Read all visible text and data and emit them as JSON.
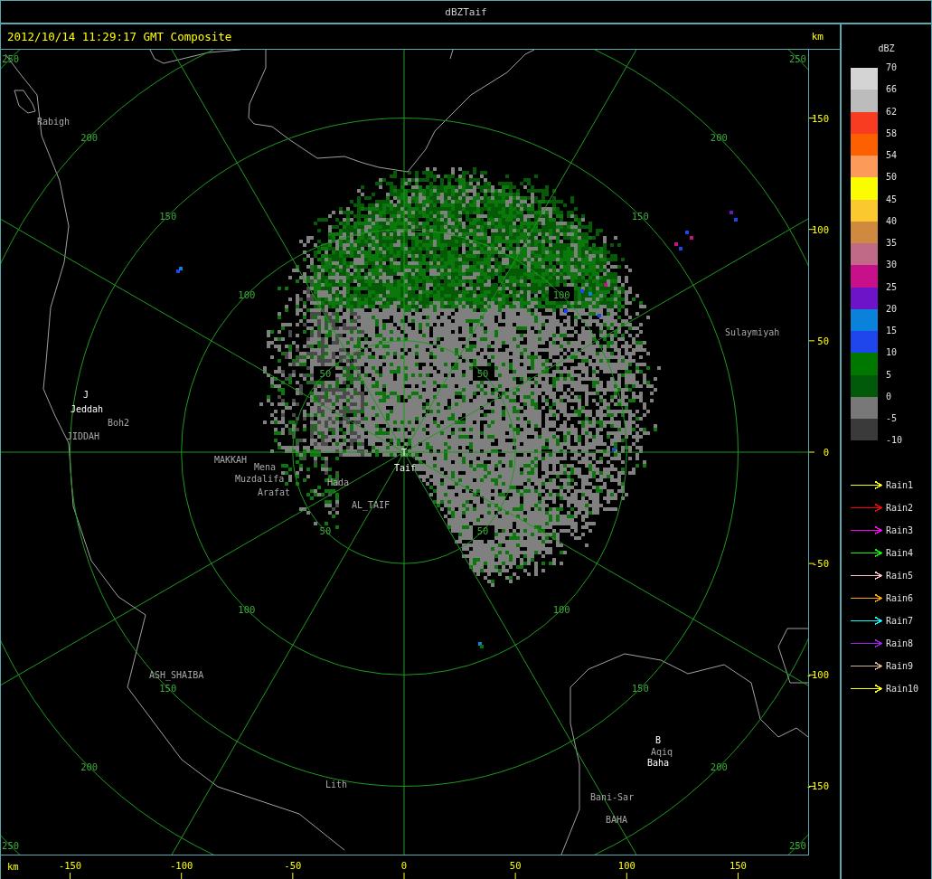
{
  "window": {
    "title": "dBZTaif"
  },
  "header": {
    "timestamp": "2012/10/14 11:29:17 GMT Composite",
    "unit": "km"
  },
  "plot": {
    "range_rings": [
      {
        "labels": [
          "50",
          "50",
          "50",
          "50"
        ]
      },
      {
        "labels": [
          "100",
          "100",
          "100",
          "100"
        ]
      },
      {
        "labels": [
          "150",
          "150",
          "150",
          "150"
        ]
      },
      {
        "labels": [
          "200",
          "200",
          "200",
          "200"
        ]
      },
      {
        "labels": [
          "250",
          "250",
          "250",
          "250"
        ]
      }
    ],
    "y_axis": {
      "ticks": [
        "150",
        "100",
        "50",
        "0",
        "-50",
        "-100",
        "-150"
      ]
    },
    "x_axis": {
      "unit": "km",
      "ticks": [
        "-150",
        "-100",
        "-50",
        "0",
        "50",
        "100",
        "150"
      ]
    },
    "places": [
      {
        "name": "Rabigh",
        "kind": "place"
      },
      {
        "name": "Sulaymiyah",
        "kind": "place"
      },
      {
        "name": "J",
        "kind": "radar"
      },
      {
        "name": "Jeddah",
        "kind": "radar"
      },
      {
        "name": "Boh2",
        "kind": "place"
      },
      {
        "name": "JIDDAH",
        "kind": "place"
      },
      {
        "name": "T",
        "kind": "radar"
      },
      {
        "name": "MAKKAH",
        "kind": "place"
      },
      {
        "name": "Mena",
        "kind": "place"
      },
      {
        "name": "Muzdalifa",
        "kind": "place"
      },
      {
        "name": "Taif",
        "kind": "radar"
      },
      {
        "name": "Hada",
        "kind": "place"
      },
      {
        "name": "Arafat",
        "kind": "place"
      },
      {
        "name": "AL_TAIF",
        "kind": "place"
      },
      {
        "name": "ASH_SHAIBA",
        "kind": "place"
      },
      {
        "name": "B",
        "kind": "radar"
      },
      {
        "name": "Aqiq",
        "kind": "place"
      },
      {
        "name": "Baha",
        "kind": "radar"
      },
      {
        "name": "Lith",
        "kind": "place"
      },
      {
        "name": "Bani-Sar",
        "kind": "place"
      },
      {
        "name": "BAHA",
        "kind": "place"
      }
    ]
  },
  "legend": {
    "title": "dBZ",
    "scale_labels": [
      "70",
      "66",
      "62",
      "58",
      "54",
      "50",
      "45",
      "40",
      "35",
      "30",
      "25",
      "20",
      "15",
      "10",
      "5",
      "0",
      "-5",
      "-10"
    ],
    "scale_bins": [
      {
        "color": "#d4d4d4"
      },
      {
        "color": "#bcbcbc"
      },
      {
        "color": "#f83c22"
      },
      {
        "color": "#fc6000"
      },
      {
        "color": "#fc9a5a"
      },
      {
        "color": "#fcfc00"
      },
      {
        "color": "#fcc830"
      },
      {
        "color": "#d08a40"
      },
      {
        "color": "#c06a88"
      },
      {
        "color": "#c8108a"
      },
      {
        "color": "#6e14c8"
      },
      {
        "color": "#0a82dc"
      },
      {
        "color": "#1e46ec"
      },
      {
        "color": "#007800"
      },
      {
        "color": "#005a0a"
      },
      {
        "color": "#787878"
      },
      {
        "color": "#3a3a3a"
      }
    ],
    "tracks": [
      {
        "name": "Rain1",
        "color": "#ffff00"
      },
      {
        "name": "Rain2",
        "color": "#ff0000"
      },
      {
        "name": "Rain3",
        "color": "#ff00ff"
      },
      {
        "name": "Rain4",
        "color": "#00ff00"
      },
      {
        "name": "Rain5",
        "color": "#ffc0cb"
      },
      {
        "name": "Rain6",
        "color": "#ffa500"
      },
      {
        "name": "Rain7",
        "color": "#00ffff"
      },
      {
        "name": "Rain8",
        "color": "#a020f0"
      },
      {
        "name": "Rain9",
        "color": "#d2b48c"
      },
      {
        "name": "Rain10",
        "color": "#ffff00"
      }
    ]
  }
}
